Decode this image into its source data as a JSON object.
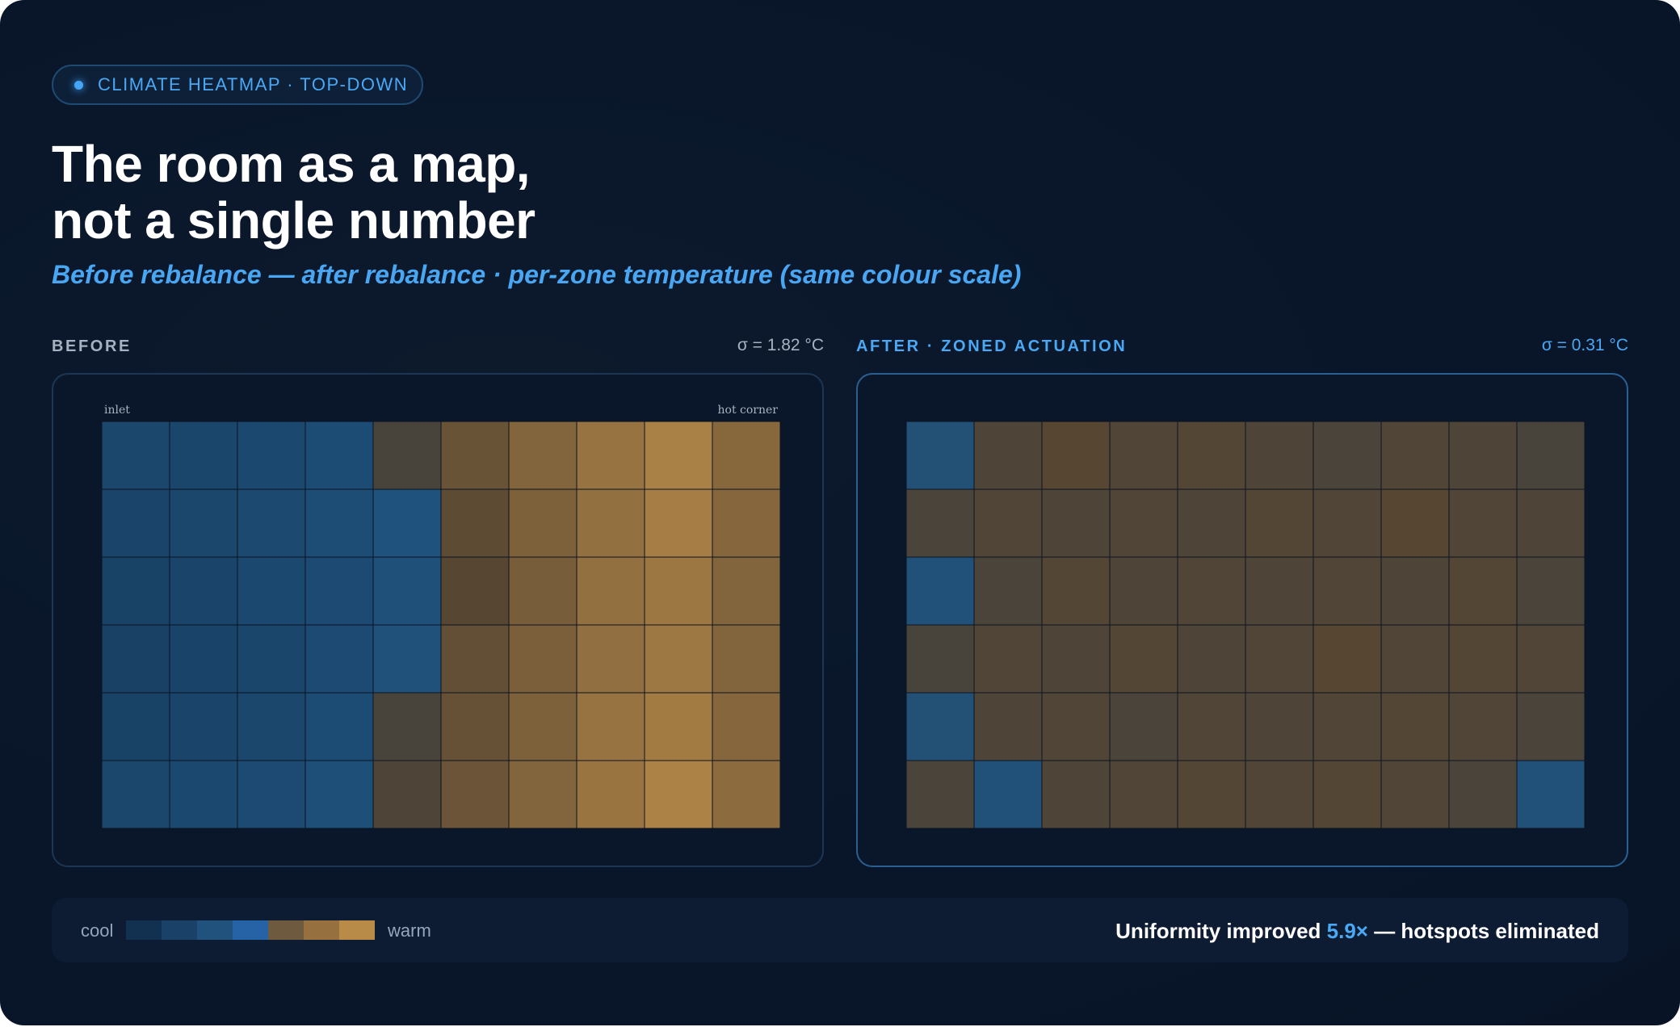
{
  "badge": {
    "label": "CLIMATE HEATMAP · TOP-DOWN",
    "icon": "status-dot-icon"
  },
  "title_line1": "The room as a map,",
  "title_line2": "not a single number",
  "subtitle": "Before rebalance — after rebalance · per-zone temperature (same colour scale)",
  "before": {
    "label": "BEFORE",
    "sigma": "σ = 1.82 °C"
  },
  "after": {
    "label": "AFTER · ZONED ACTUATION",
    "sigma": "σ = 0.31 °C"
  },
  "legend": {
    "cool": "cool",
    "warm": "warm",
    "swatches": [
      "#12304f",
      "#1a4268",
      "#21527e",
      "#2662a6",
      "#6e5a3e",
      "#96703f",
      "#b98b48"
    ]
  },
  "summary": {
    "prefix": "Uniformity improved ",
    "highlight": "5.9×",
    "suffix": " — hotspots eliminated"
  },
  "colors": {
    "accent": "#4aa8f5",
    "before_label": "#a6b2c2",
    "after_label": "#4aa8f5"
  },
  "chart_data": [
    {
      "type": "heatmap",
      "name": "before",
      "title": "BEFORE",
      "corner_labels": {
        "left": "inlet",
        "right": "hot corner"
      },
      "rows": 6,
      "cols": 10,
      "values": [
        [
          0.2,
          0.19,
          0.21,
          0.24,
          0.5,
          0.62,
          0.72,
          0.82,
          0.92,
          0.74
        ],
        [
          0.18,
          0.2,
          0.22,
          0.25,
          0.3,
          0.58,
          0.7,
          0.8,
          0.9,
          0.73
        ],
        [
          0.16,
          0.18,
          0.21,
          0.23,
          0.28,
          0.55,
          0.68,
          0.8,
          0.85,
          0.72
        ],
        [
          0.15,
          0.17,
          0.19,
          0.23,
          0.29,
          0.6,
          0.69,
          0.79,
          0.86,
          0.72
        ],
        [
          0.16,
          0.18,
          0.2,
          0.24,
          0.5,
          0.61,
          0.7,
          0.82,
          0.88,
          0.73
        ],
        [
          0.2,
          0.21,
          0.23,
          0.27,
          0.52,
          0.63,
          0.72,
          0.83,
          0.94,
          0.76
        ]
      ]
    },
    {
      "type": "heatmap",
      "name": "after",
      "title": "AFTER · ZONED ACTUATION",
      "rows": 6,
      "cols": 10,
      "values": [
        [
          0.32,
          0.52,
          0.55,
          0.53,
          0.54,
          0.52,
          0.51,
          0.53,
          0.52,
          0.5
        ],
        [
          0.51,
          0.53,
          0.52,
          0.53,
          0.52,
          0.54,
          0.53,
          0.55,
          0.53,
          0.52
        ],
        [
          0.31,
          0.51,
          0.54,
          0.52,
          0.53,
          0.52,
          0.53,
          0.52,
          0.54,
          0.51
        ],
        [
          0.5,
          0.53,
          0.52,
          0.54,
          0.52,
          0.53,
          0.55,
          0.53,
          0.54,
          0.53
        ],
        [
          0.32,
          0.52,
          0.53,
          0.51,
          0.53,
          0.52,
          0.53,
          0.54,
          0.53,
          0.51
        ],
        [
          0.51,
          0.31,
          0.52,
          0.53,
          0.54,
          0.53,
          0.54,
          0.53,
          0.51,
          0.31
        ]
      ]
    }
  ]
}
